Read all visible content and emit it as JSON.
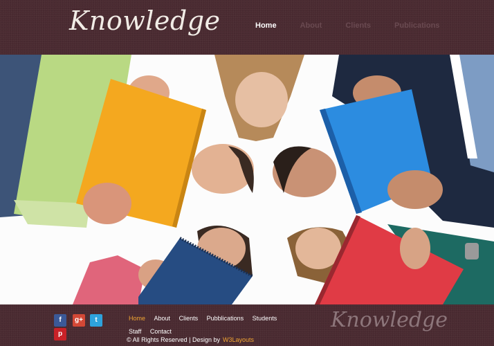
{
  "header": {
    "logo": "Knowledge",
    "nav": [
      {
        "label": "Home",
        "active": true
      },
      {
        "label": "About",
        "active": false
      },
      {
        "label": "Clients",
        "active": false
      },
      {
        "label": "Publications",
        "active": false
      }
    ]
  },
  "footer": {
    "social": [
      {
        "name": "facebook",
        "glyph": "f",
        "color": "#3b5998"
      },
      {
        "name": "google-plus",
        "glyph": "g+",
        "color": "#d34836"
      },
      {
        "name": "twitter",
        "glyph": "t",
        "color": "#2ea2dc"
      },
      {
        "name": "pinterest",
        "glyph": "p",
        "color": "#c92228"
      }
    ],
    "nav": [
      {
        "label": "Home",
        "active": true
      },
      {
        "label": "About",
        "active": false
      },
      {
        "label": "Clients",
        "active": false
      },
      {
        "label": "Pubblications",
        "active": false
      },
      {
        "label": "Students",
        "active": false
      },
      {
        "label": "Staff",
        "active": false
      },
      {
        "label": "Contact",
        "active": false
      }
    ],
    "copyright": "© All Rights Reserved | Design by",
    "designer": "W3Layouts",
    "logo": "Knowledge"
  },
  "colors": {
    "header_bg": "#4a2a31",
    "accent": "#f2a633"
  }
}
